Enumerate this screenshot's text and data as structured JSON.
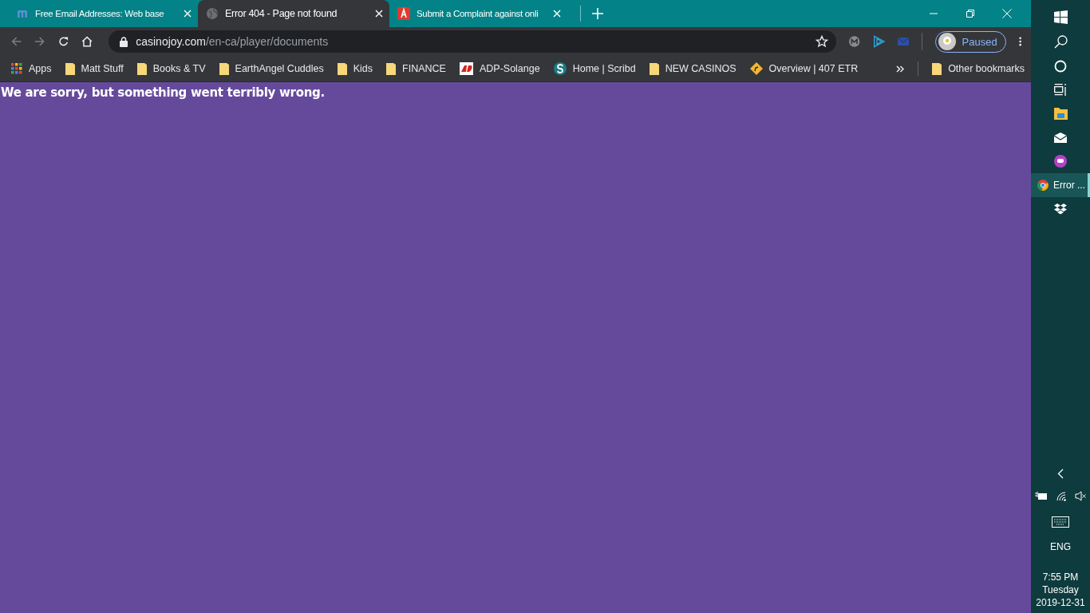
{
  "tabs": [
    {
      "kind": "m",
      "title": "Free Email Addresses: Web base",
      "selected": false
    },
    {
      "kind": "globe",
      "title": "Error 404 - Page not found",
      "selected": true
    },
    {
      "kind": "a",
      "title": "Submit a Complaint against onli",
      "selected": false
    }
  ],
  "address": {
    "domain": "casinojoy.com",
    "path": "/en-ca/player/documents"
  },
  "profile": {
    "status": "Paused"
  },
  "bookmarks": [
    {
      "kind": "apps",
      "label": "Apps"
    },
    {
      "kind": "folder",
      "label": "Matt Stuff"
    },
    {
      "kind": "folder",
      "label": "Books & TV"
    },
    {
      "kind": "folder",
      "label": "EarthAngel Cuddles"
    },
    {
      "kind": "folder",
      "label": "Kids"
    },
    {
      "kind": "folder",
      "label": "FINANCE"
    },
    {
      "kind": "adp",
      "label": "ADP-Solange"
    },
    {
      "kind": "scribd",
      "label": "Home | Scribd"
    },
    {
      "kind": "folder",
      "label": "NEW CASINOS"
    },
    {
      "kind": "diamond",
      "label": "Overview | 407 ETR"
    }
  ],
  "other_bookmarks": {
    "label": "Other bookmarks"
  },
  "page": {
    "message": "We are sorry, but something went terribly wrong."
  },
  "taskbar": {
    "apps": [
      {
        "kind": "explorer",
        "selected": false
      },
      {
        "kind": "mail",
        "selected": false
      },
      {
        "kind": "messenger",
        "selected": false
      },
      {
        "kind": "chrome",
        "label": "Error ...",
        "selected": true
      },
      {
        "kind": "dropbox",
        "selected": false
      }
    ],
    "language": "ENG",
    "time": "7:55 PM",
    "day": "Tuesday",
    "date": "2019-12-31"
  }
}
